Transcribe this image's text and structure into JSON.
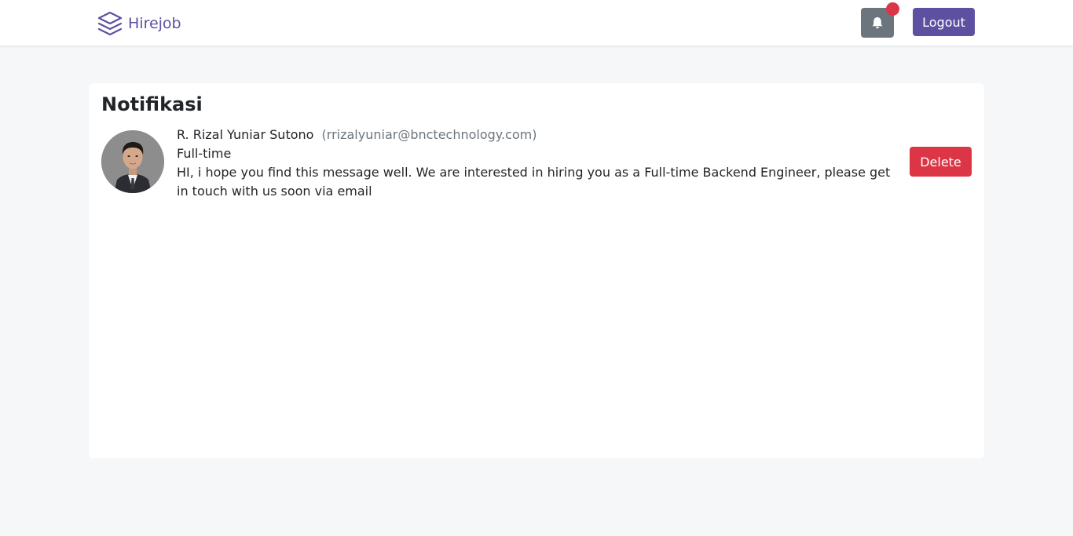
{
  "navbar": {
    "brand_name": "Hirejob",
    "brand_icon": "stacked-layers-icon",
    "notification_icon": "bell-icon",
    "logout_label": "Logout"
  },
  "notifications": {
    "title": "Notifikasi",
    "items": [
      {
        "sender_name": "R. Rizal Yuniar Sutono",
        "sender_email": "(rrizalyuniar@bnctechnology.com)",
        "job_type": "Full-time",
        "message": "HI, i hope you find this message well. We are interested in hiring you as a Full-time Backend Engineer, please get in touch with us soon via email",
        "delete_label": "Delete"
      }
    ]
  },
  "colors": {
    "brand": "#5e50a1",
    "danger": "#dc3545",
    "secondary": "#6c757d",
    "page_background": "#f6f7f9"
  }
}
